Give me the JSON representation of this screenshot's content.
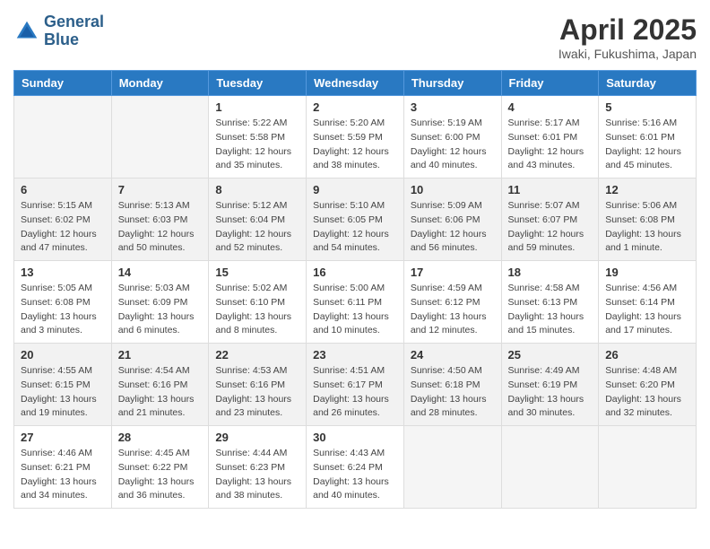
{
  "header": {
    "logo_line1": "General",
    "logo_line2": "Blue",
    "month": "April 2025",
    "location": "Iwaki, Fukushima, Japan"
  },
  "weekdays": [
    "Sunday",
    "Monday",
    "Tuesday",
    "Wednesday",
    "Thursday",
    "Friday",
    "Saturday"
  ],
  "weeks": [
    [
      {
        "day": "",
        "info": ""
      },
      {
        "day": "",
        "info": ""
      },
      {
        "day": "1",
        "info": "Sunrise: 5:22 AM\nSunset: 5:58 PM\nDaylight: 12 hours\nand 35 minutes."
      },
      {
        "day": "2",
        "info": "Sunrise: 5:20 AM\nSunset: 5:59 PM\nDaylight: 12 hours\nand 38 minutes."
      },
      {
        "day": "3",
        "info": "Sunrise: 5:19 AM\nSunset: 6:00 PM\nDaylight: 12 hours\nand 40 minutes."
      },
      {
        "day": "4",
        "info": "Sunrise: 5:17 AM\nSunset: 6:01 PM\nDaylight: 12 hours\nand 43 minutes."
      },
      {
        "day": "5",
        "info": "Sunrise: 5:16 AM\nSunset: 6:01 PM\nDaylight: 12 hours\nand 45 minutes."
      }
    ],
    [
      {
        "day": "6",
        "info": "Sunrise: 5:15 AM\nSunset: 6:02 PM\nDaylight: 12 hours\nand 47 minutes."
      },
      {
        "day": "7",
        "info": "Sunrise: 5:13 AM\nSunset: 6:03 PM\nDaylight: 12 hours\nand 50 minutes."
      },
      {
        "day": "8",
        "info": "Sunrise: 5:12 AM\nSunset: 6:04 PM\nDaylight: 12 hours\nand 52 minutes."
      },
      {
        "day": "9",
        "info": "Sunrise: 5:10 AM\nSunset: 6:05 PM\nDaylight: 12 hours\nand 54 minutes."
      },
      {
        "day": "10",
        "info": "Sunrise: 5:09 AM\nSunset: 6:06 PM\nDaylight: 12 hours\nand 56 minutes."
      },
      {
        "day": "11",
        "info": "Sunrise: 5:07 AM\nSunset: 6:07 PM\nDaylight: 12 hours\nand 59 minutes."
      },
      {
        "day": "12",
        "info": "Sunrise: 5:06 AM\nSunset: 6:08 PM\nDaylight: 13 hours\nand 1 minute."
      }
    ],
    [
      {
        "day": "13",
        "info": "Sunrise: 5:05 AM\nSunset: 6:08 PM\nDaylight: 13 hours\nand 3 minutes."
      },
      {
        "day": "14",
        "info": "Sunrise: 5:03 AM\nSunset: 6:09 PM\nDaylight: 13 hours\nand 6 minutes."
      },
      {
        "day": "15",
        "info": "Sunrise: 5:02 AM\nSunset: 6:10 PM\nDaylight: 13 hours\nand 8 minutes."
      },
      {
        "day": "16",
        "info": "Sunrise: 5:00 AM\nSunset: 6:11 PM\nDaylight: 13 hours\nand 10 minutes."
      },
      {
        "day": "17",
        "info": "Sunrise: 4:59 AM\nSunset: 6:12 PM\nDaylight: 13 hours\nand 12 minutes."
      },
      {
        "day": "18",
        "info": "Sunrise: 4:58 AM\nSunset: 6:13 PM\nDaylight: 13 hours\nand 15 minutes."
      },
      {
        "day": "19",
        "info": "Sunrise: 4:56 AM\nSunset: 6:14 PM\nDaylight: 13 hours\nand 17 minutes."
      }
    ],
    [
      {
        "day": "20",
        "info": "Sunrise: 4:55 AM\nSunset: 6:15 PM\nDaylight: 13 hours\nand 19 minutes."
      },
      {
        "day": "21",
        "info": "Sunrise: 4:54 AM\nSunset: 6:16 PM\nDaylight: 13 hours\nand 21 minutes."
      },
      {
        "day": "22",
        "info": "Sunrise: 4:53 AM\nSunset: 6:16 PM\nDaylight: 13 hours\nand 23 minutes."
      },
      {
        "day": "23",
        "info": "Sunrise: 4:51 AM\nSunset: 6:17 PM\nDaylight: 13 hours\nand 26 minutes."
      },
      {
        "day": "24",
        "info": "Sunrise: 4:50 AM\nSunset: 6:18 PM\nDaylight: 13 hours\nand 28 minutes."
      },
      {
        "day": "25",
        "info": "Sunrise: 4:49 AM\nSunset: 6:19 PM\nDaylight: 13 hours\nand 30 minutes."
      },
      {
        "day": "26",
        "info": "Sunrise: 4:48 AM\nSunset: 6:20 PM\nDaylight: 13 hours\nand 32 minutes."
      }
    ],
    [
      {
        "day": "27",
        "info": "Sunrise: 4:46 AM\nSunset: 6:21 PM\nDaylight: 13 hours\nand 34 minutes."
      },
      {
        "day": "28",
        "info": "Sunrise: 4:45 AM\nSunset: 6:22 PM\nDaylight: 13 hours\nand 36 minutes."
      },
      {
        "day": "29",
        "info": "Sunrise: 4:44 AM\nSunset: 6:23 PM\nDaylight: 13 hours\nand 38 minutes."
      },
      {
        "day": "30",
        "info": "Sunrise: 4:43 AM\nSunset: 6:24 PM\nDaylight: 13 hours\nand 40 minutes."
      },
      {
        "day": "",
        "info": ""
      },
      {
        "day": "",
        "info": ""
      },
      {
        "day": "",
        "info": ""
      }
    ]
  ]
}
